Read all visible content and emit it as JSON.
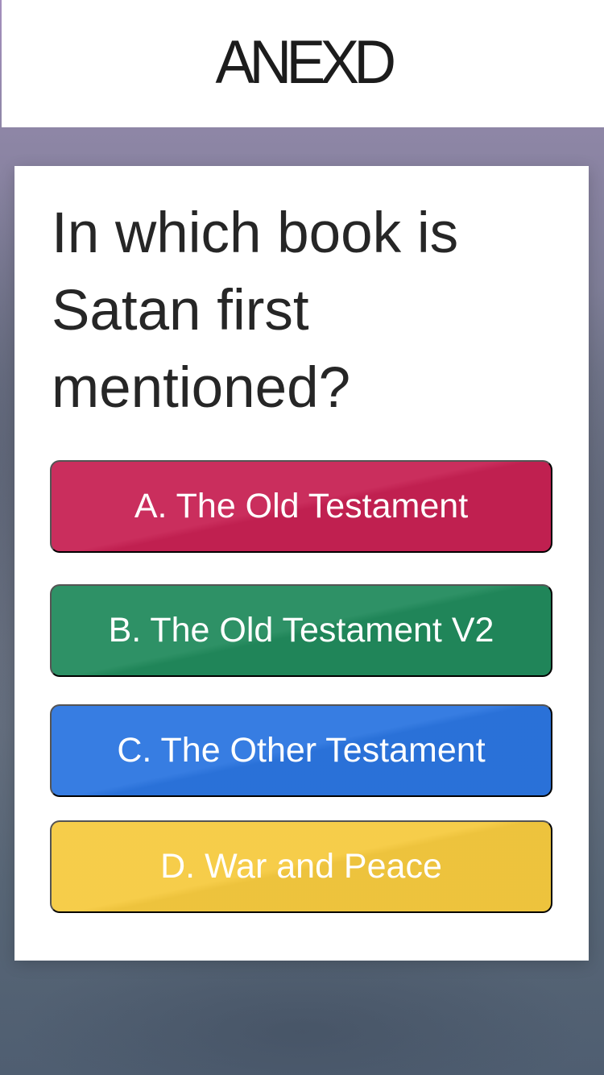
{
  "header": {
    "logo": "ANEXD"
  },
  "quiz": {
    "question": "In which book is Satan first mentioned?",
    "answers": [
      {
        "label": "A. The Old Testament",
        "color": "#c72153"
      },
      {
        "label": "B. The Old Testament V2",
        "color": "#218a5c"
      },
      {
        "label": "C. The Other Testament",
        "color": "#2b75e0"
      },
      {
        "label": "D. War and Peace",
        "color": "#f6ca3f"
      }
    ]
  }
}
